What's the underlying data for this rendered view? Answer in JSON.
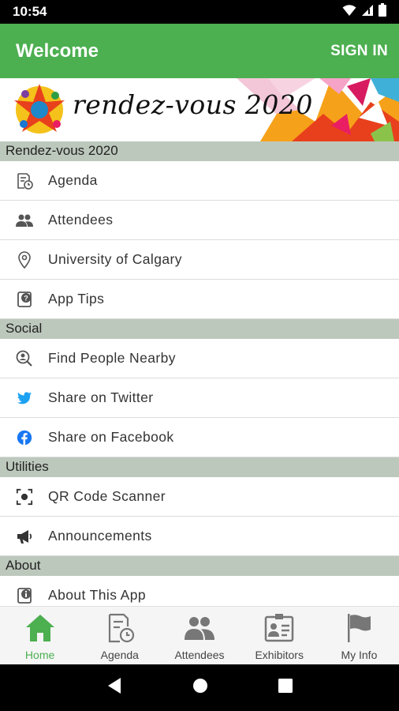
{
  "status_bar": {
    "time": "10:54"
  },
  "app_bar": {
    "title": "Welcome",
    "sign_in": "SIGN IN"
  },
  "banner": {
    "text": "rendez-vous 2020"
  },
  "sections": [
    {
      "title": "Rendez-vous 2020",
      "items": [
        {
          "label": "Agenda",
          "icon": "agenda-icon"
        },
        {
          "label": "Attendees",
          "icon": "attendees-icon"
        },
        {
          "label": "University of Calgary",
          "icon": "location-pin-icon"
        },
        {
          "label": "App Tips",
          "icon": "app-tips-icon"
        }
      ]
    },
    {
      "title": "Social",
      "items": [
        {
          "label": "Find People Nearby",
          "icon": "find-people-icon"
        },
        {
          "label": "Share on Twitter",
          "icon": "twitter-icon"
        },
        {
          "label": "Share on Facebook",
          "icon": "facebook-icon"
        }
      ]
    },
    {
      "title": "Utilities",
      "items": [
        {
          "label": "QR Code Scanner",
          "icon": "qr-scanner-icon"
        },
        {
          "label": "Announcements",
          "icon": "megaphone-icon"
        }
      ]
    },
    {
      "title": "About",
      "items": [
        {
          "label": "About This App",
          "icon": "info-icon"
        }
      ]
    }
  ],
  "bottom_nav": {
    "items": [
      {
        "label": "Home",
        "icon": "home-icon",
        "active": true
      },
      {
        "label": "Agenda",
        "icon": "agenda-icon",
        "active": false
      },
      {
        "label": "Attendees",
        "icon": "attendees-icon",
        "active": false
      },
      {
        "label": "Exhibitors",
        "icon": "exhibitors-icon",
        "active": false
      },
      {
        "label": "My Info",
        "icon": "flag-icon",
        "active": false
      }
    ]
  },
  "colors": {
    "primary": "#4caf50",
    "section_header": "#bdc8bd",
    "twitter": "#1da1f2",
    "facebook": "#1877f2"
  }
}
